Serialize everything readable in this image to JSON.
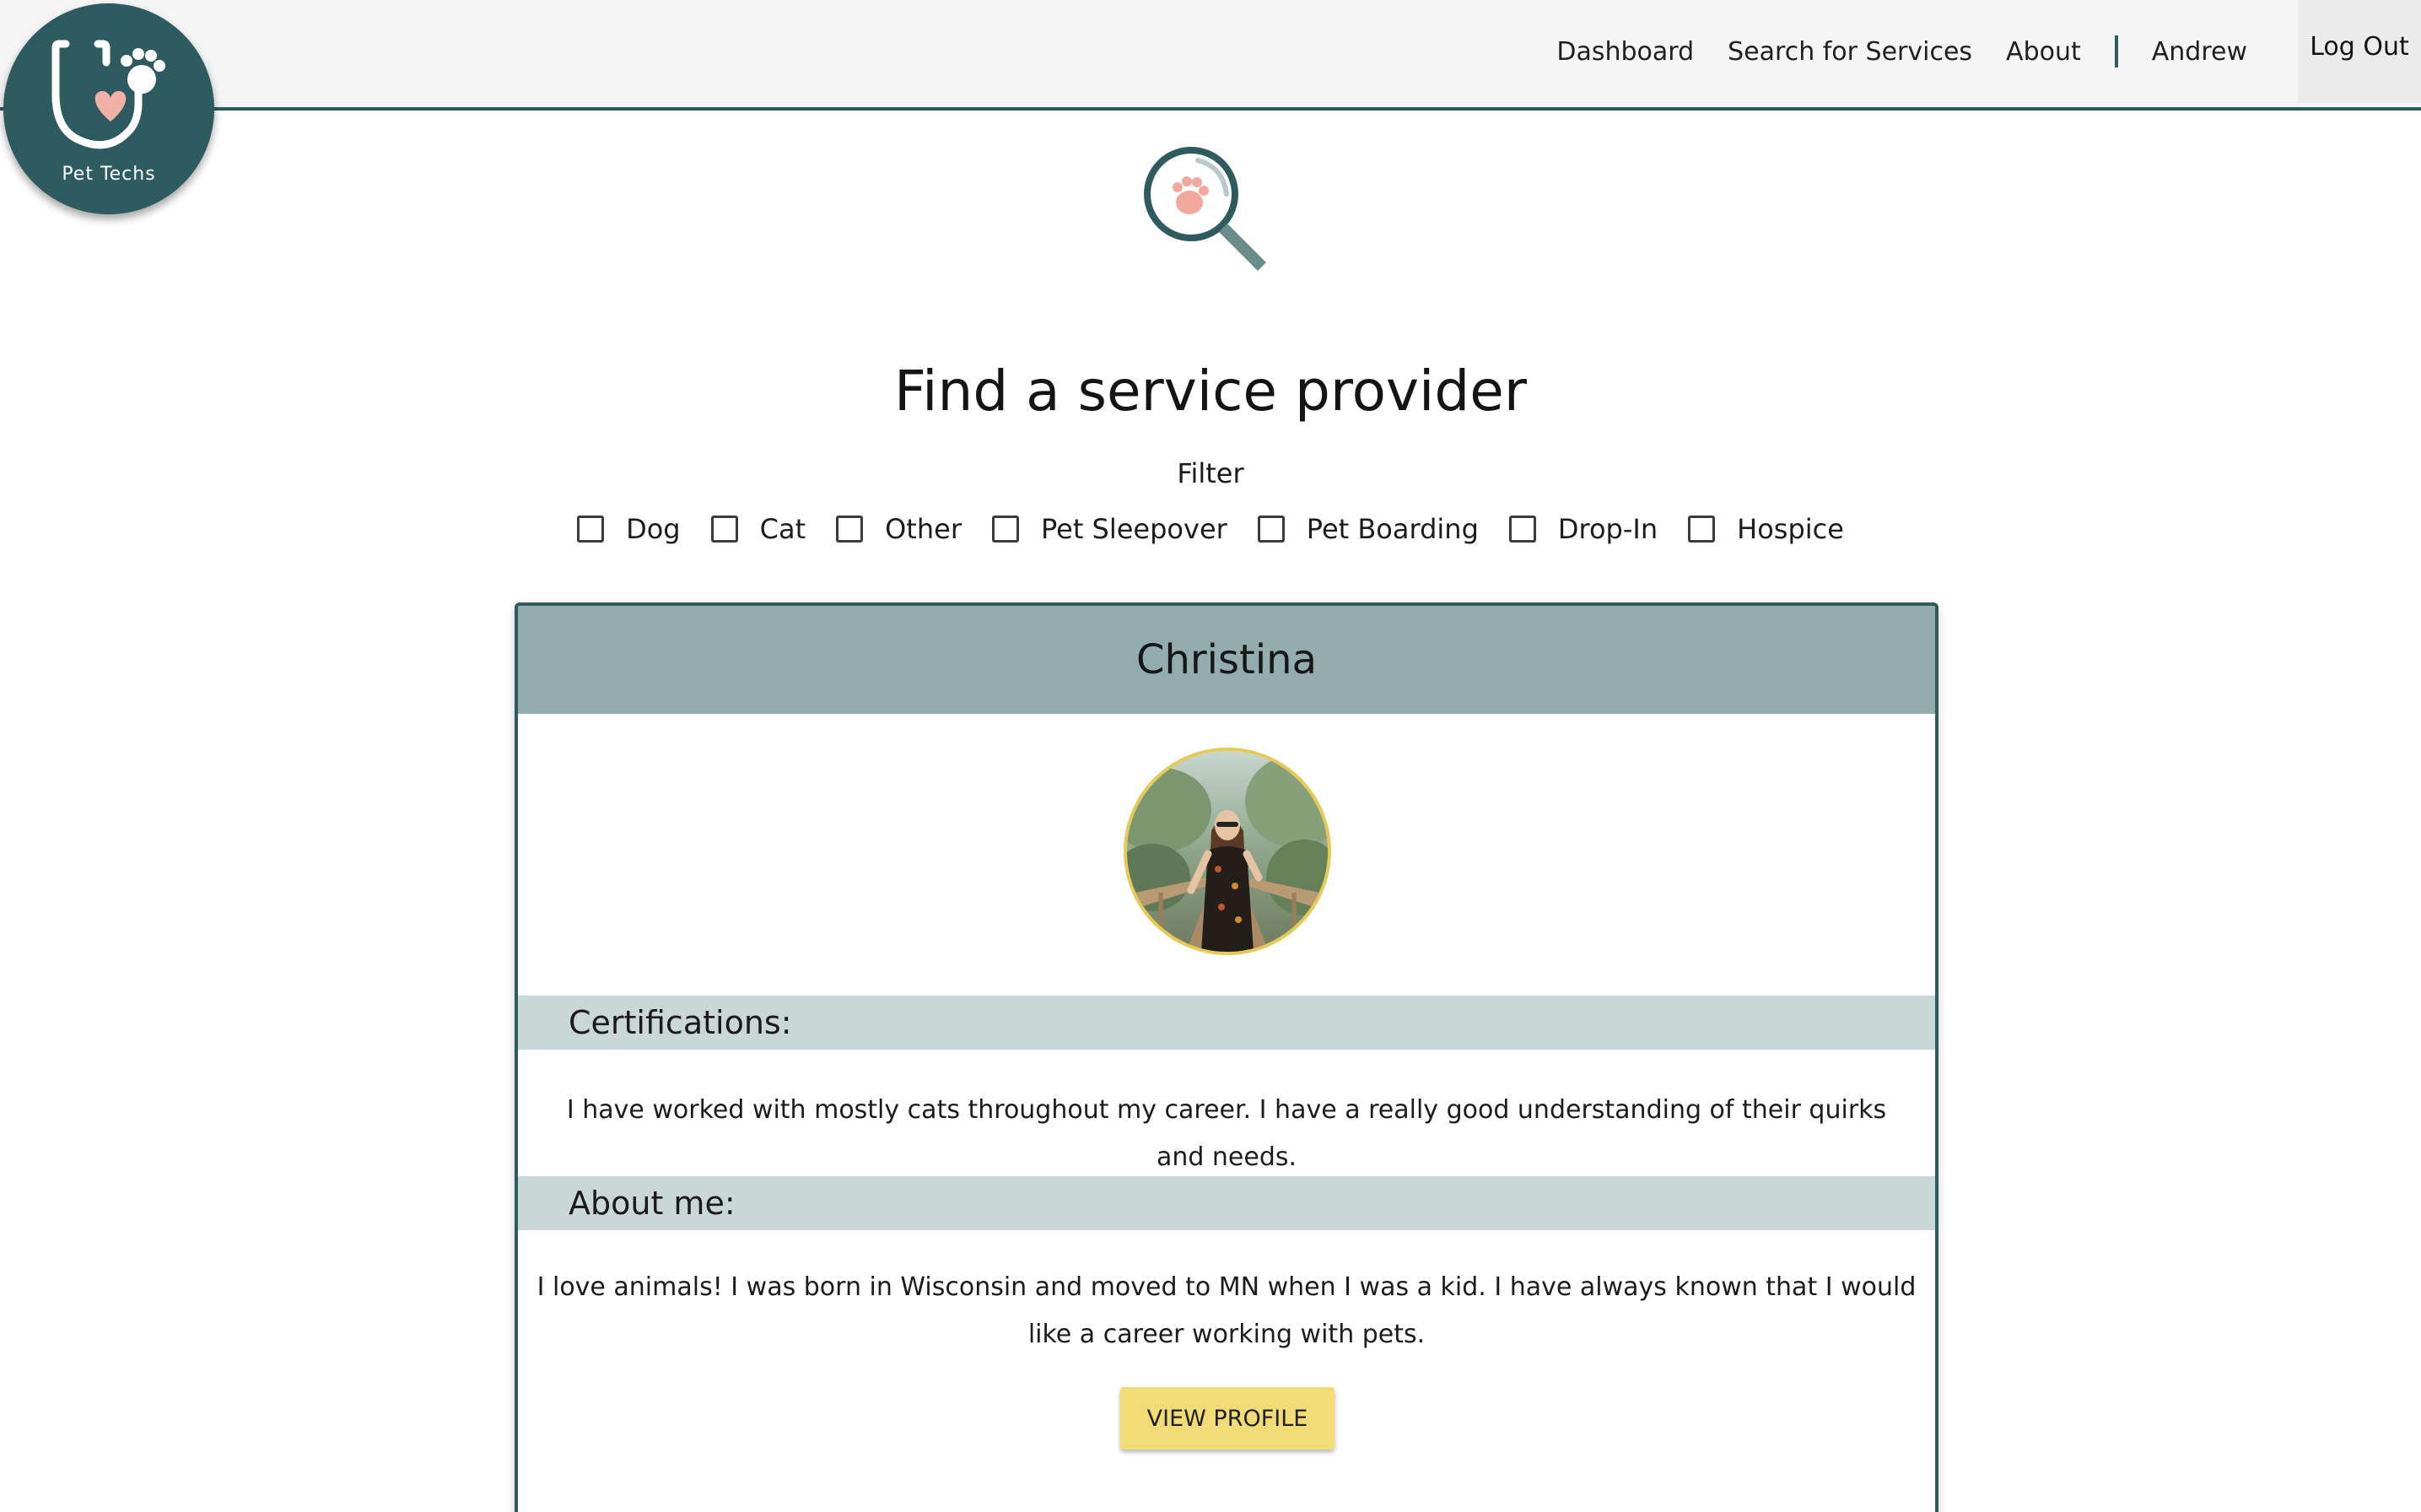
{
  "brand": {
    "name": "Pet Techs",
    "primary_color": "#2d5b60",
    "accent_color": "#f2dc78",
    "logo_icons": [
      "stethoscope-icon",
      "heart-icon",
      "paw-icon"
    ]
  },
  "nav": {
    "dashboard": "Dashboard",
    "search": "Search for Services",
    "about": "About",
    "user": "Andrew",
    "logout": "Log Out"
  },
  "main": {
    "illustration_icon": "magnifier-paw-icon",
    "title": "Find a service provider",
    "filter_label": "Filter",
    "filters": [
      {
        "label": "Dog",
        "checked": false
      },
      {
        "label": "Cat",
        "checked": false
      },
      {
        "label": "Other",
        "checked": false
      },
      {
        "label": "Pet Sleepover",
        "checked": false
      },
      {
        "label": "Pet Boarding",
        "checked": false
      },
      {
        "label": "Drop-In",
        "checked": false
      },
      {
        "label": "Hospice",
        "checked": false
      }
    ]
  },
  "providers": [
    {
      "name": "Christina",
      "certifications_heading": "Certifications:",
      "certifications_text": "I have worked with mostly cats throughout my career. I have a really good understanding of their quirks and needs.",
      "about_heading": "About me:",
      "about_text": "I love animals! I was born in Wisconsin and moved to MN when I was a kid. I have always known that I would like a career working with pets.",
      "view_label": "VIEW PROFILE"
    }
  ]
}
